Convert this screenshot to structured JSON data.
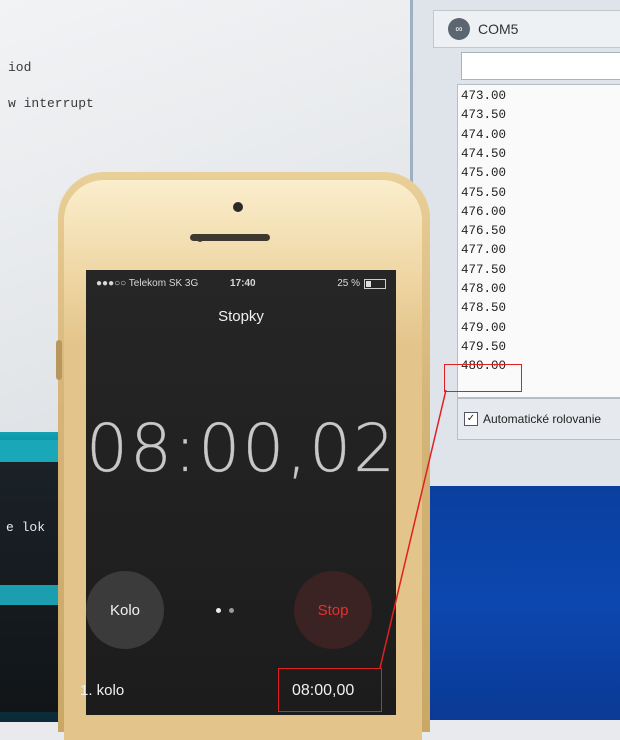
{
  "editor": {
    "lines": [
      "iod",
      "w interrupt",
      "e lok"
    ]
  },
  "serial_monitor": {
    "title": "COM5",
    "logo": "serial-monitor-logo-icon",
    "input_value": "",
    "output_lines": [
      "473.00",
      "473.50",
      "474.00",
      "474.50",
      "475.00",
      "475.50",
      "476.00",
      "476.50",
      "477.00",
      "477.50",
      "478.00",
      "478.50",
      "479.00",
      "479.50",
      "480.00"
    ],
    "highlighted_value": "480.00",
    "autoscroll_label": "Automatické rolovanie",
    "autoscroll_checked": true
  },
  "phone": {
    "status": {
      "carrier": "●●●○○ Telekom SK  3G",
      "time": "17:40",
      "battery": "25 %",
      "battery_level": 0.25
    },
    "screen_title": "Stopky",
    "main_time": "08:00,02",
    "lap_button": "Kolo",
    "stop_button": "Stop",
    "lap_label": "1. kolo",
    "lap_time": "08:00,00"
  },
  "colors": {
    "highlight_red": "#e02020",
    "stop_red": "#e8302c",
    "phone_gold": "#e3c48a"
  }
}
